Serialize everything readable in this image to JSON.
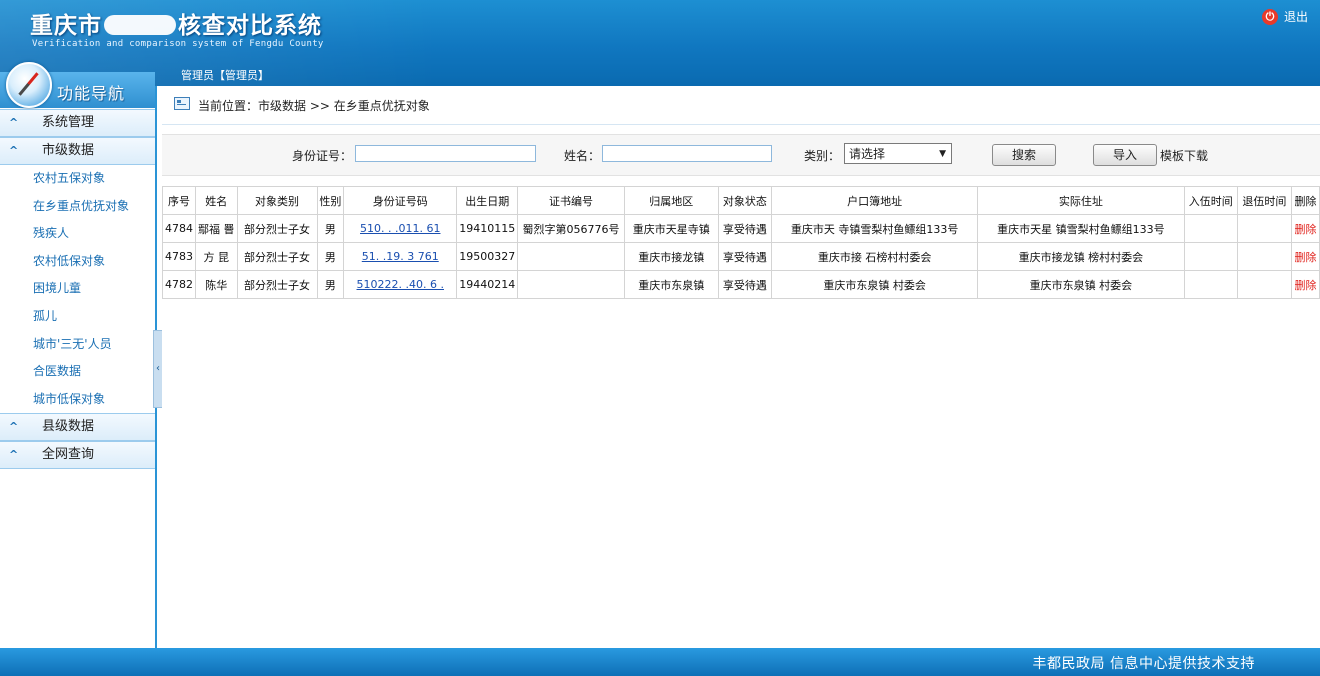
{
  "header": {
    "title_left": "重庆市",
    "title_right": "核查对比系统",
    "subtitle": "Verification and comparison system of Fengdu County",
    "logout_label": "退出",
    "user_label": "管理员【管理员】"
  },
  "nav": {
    "title": "功能导航",
    "groups": [
      {
        "label": "系统管理"
      },
      {
        "label": "市级数据"
      },
      {
        "label": "县级数据"
      },
      {
        "label": "全网查询"
      }
    ],
    "city_items": [
      "农村五保对象",
      "在乡重点优抚对象",
      "残疾人",
      "农村低保对象",
      "困境儿童",
      "孤儿",
      "城市'三无'人员",
      "合医数据",
      "城市低保对象"
    ]
  },
  "breadcrumb": "当前位置：市级数据 >> 在乡重点优抚对象",
  "search": {
    "id_label": "身份证号：",
    "id_value": "",
    "name_label": "姓名：",
    "name_value": "",
    "type_label": "类别：",
    "type_selected": "请选择",
    "search_button": "搜索",
    "import_button": "导入",
    "template_link": "模板下载"
  },
  "table": {
    "headers": [
      "序号",
      "姓名",
      "对象类别",
      "性别",
      "身份证号码",
      "出生日期",
      "证书编号",
      "归属地区",
      "对象状态",
      "户口簿地址",
      "实际住址",
      "入伍时间",
      "退伍时间",
      "删除"
    ],
    "rows": [
      [
        "4784",
        "鄢福 罾",
        "部分烈士子女",
        "男",
        "510.  .  .011. 61",
        "19410115",
        "蜀烈字第056776号",
        "重庆市天星寺镇",
        "享受待遇",
        "重庆市天  寺镇雪梨村鱼鳔组133号",
        "重庆市天星  镇雪梨村鱼鳔组133号",
        "",
        "",
        "删除"
      ],
      [
        "4783",
        "方  昆",
        "部分烈士子女",
        "男",
        "51.  .19.  3  761",
        "19500327",
        "",
        "重庆市接龙镇",
        "享受待遇",
        "重庆市接  石榜村村委会",
        "重庆市接龙镇  榜村村委会",
        "",
        "",
        "删除"
      ],
      [
        "4782",
        "陈华  ",
        "部分烈士子女",
        "男",
        "510222.  .40.  6 .",
        "19440214",
        "",
        "重庆市东泉镇",
        "享受待遇",
        "重庆市东泉镇  村委会",
        "重庆市东泉镇  村委会",
        "",
        "",
        "删除"
      ]
    ]
  },
  "footer": "丰都民政局 信息中心提供技术支持",
  "colors": {
    "header_blue": "#1077c0",
    "link_blue": "#1a4fb0",
    "delete_red": "#e0201a"
  }
}
